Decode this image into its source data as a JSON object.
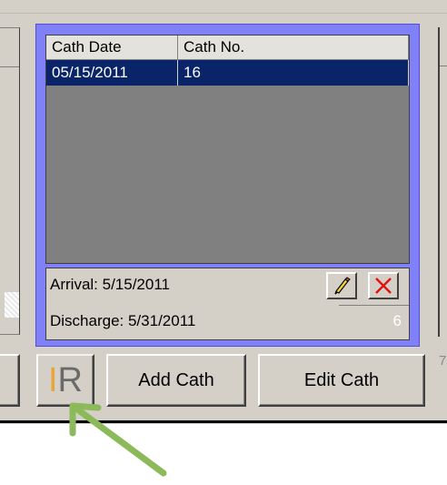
{
  "grid": {
    "columns": [
      "Cath Date",
      "Cath No."
    ],
    "rows": [
      {
        "date": "05/15/2011",
        "number": "16"
      }
    ]
  },
  "info": {
    "arrival": "Arrival: 5/15/2011",
    "discharge": "Discharge: 5/31/2011",
    "count": "6"
  },
  "buttons": {
    "ir_i": "I",
    "ir_r": "R",
    "add": "Add Cath",
    "edit": "Edit Cath"
  },
  "edge_number": "7",
  "icons": {
    "edit": "pencil-icon",
    "delete": "red-x-icon",
    "annotation": "green-arrow-icon"
  },
  "colors": {
    "focus_border": "#8080f8",
    "selection": "#0a246a",
    "arrow": "#8cba5a",
    "ir_i": "#e8a53a"
  }
}
